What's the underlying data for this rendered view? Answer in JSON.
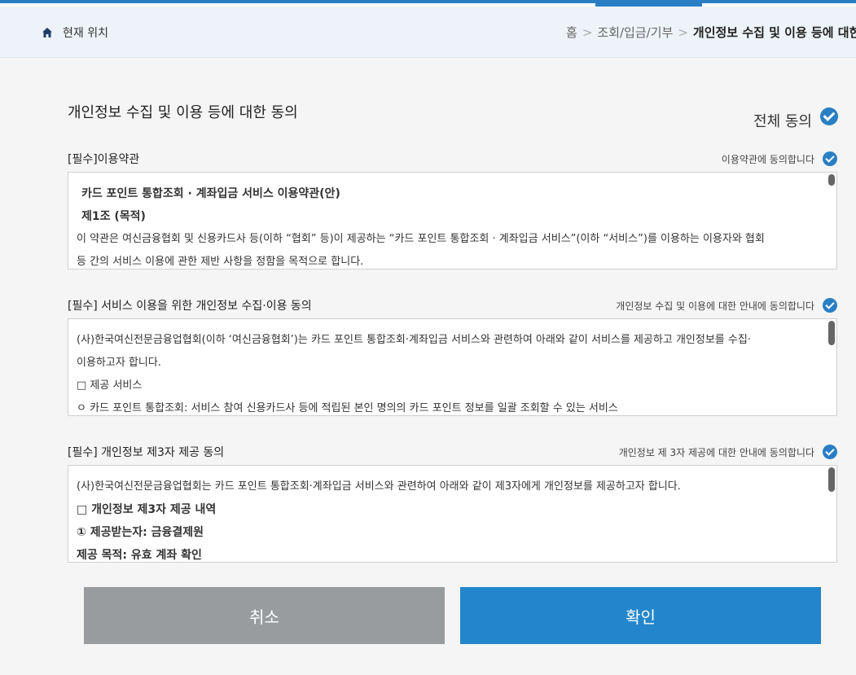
{
  "location": {
    "label": "현재 위치",
    "breadcrumb": [
      "홈",
      "조회/입금/기부"
    ],
    "current": "개인정보 수집 및 이용 등에 대한 동의",
    "separator": ">"
  },
  "page_title": "개인정보 수집 및 이용 등에 대한 동의",
  "all_agree_label": "전체 동의",
  "sections": [
    {
      "title": "[필수]이용약관",
      "agree_label": "이용약관에 동의합니다",
      "lines": [
        "카드 포인트 통합조회 · 계좌입금 서비스 이용약관(안)",
        "제1조 (목적)",
        "이 약관은 여신금융협회 및 신용카드사 등(이하 “협회” 등)이 제공하는 “카드 포인트 통합조회 · 계좌입금 서비스”(이하 “서비스”)를 이용하는 이용자와 협회",
        "등 간의 서비스 이용에 관한 제반 사항을 정함을 목적으로 합니다."
      ]
    },
    {
      "title": "[필수] 서비스 이용을 위한 개인정보 수집·이용 동의",
      "agree_label": "개인정보 수집 및 이용에 대한 안내에 동의합니다",
      "lines": [
        "(사)한국여신전문금융업협회(이하 ‘여신금융협회’)는 카드 포인트 통합조회·계좌입금 서비스와 관련하여 아래와 같이 서비스를 제공하고 개인정보를 수집·",
        "이용하고자 합니다.",
        "□ 제공 서비스",
        "ㅇ 카드 포인트 통합조회: 서비스 참여 신용카드사 등에 적립된 본인 명의의 카드 포인트 정보를 일괄 조회할 수 있는 서비스"
      ]
    },
    {
      "title": "[필수] 개인정보 제3자 제공 동의",
      "agree_label": "개인정보 제 3자 제공에 대한 안내에 동의합니다",
      "lines": [
        "(사)한국여신전문금융업협회는 카드 포인트 통합조회·계좌입금 서비스와 관련하여 아래와 같이 제3자에게 개인정보를 제공하고자 합니다.",
        "□ 개인정보 제3자 제공 내역",
        "① 제공받는자: 금융결제원",
        "제공 목적: 유효 계좌 확인"
      ]
    }
  ],
  "buttons": {
    "cancel": "취소",
    "confirm": "확인"
  },
  "colors": {
    "accent": "#2a7fc4",
    "confirm_button": "#2386cc",
    "cancel_button": "#999c9f"
  }
}
